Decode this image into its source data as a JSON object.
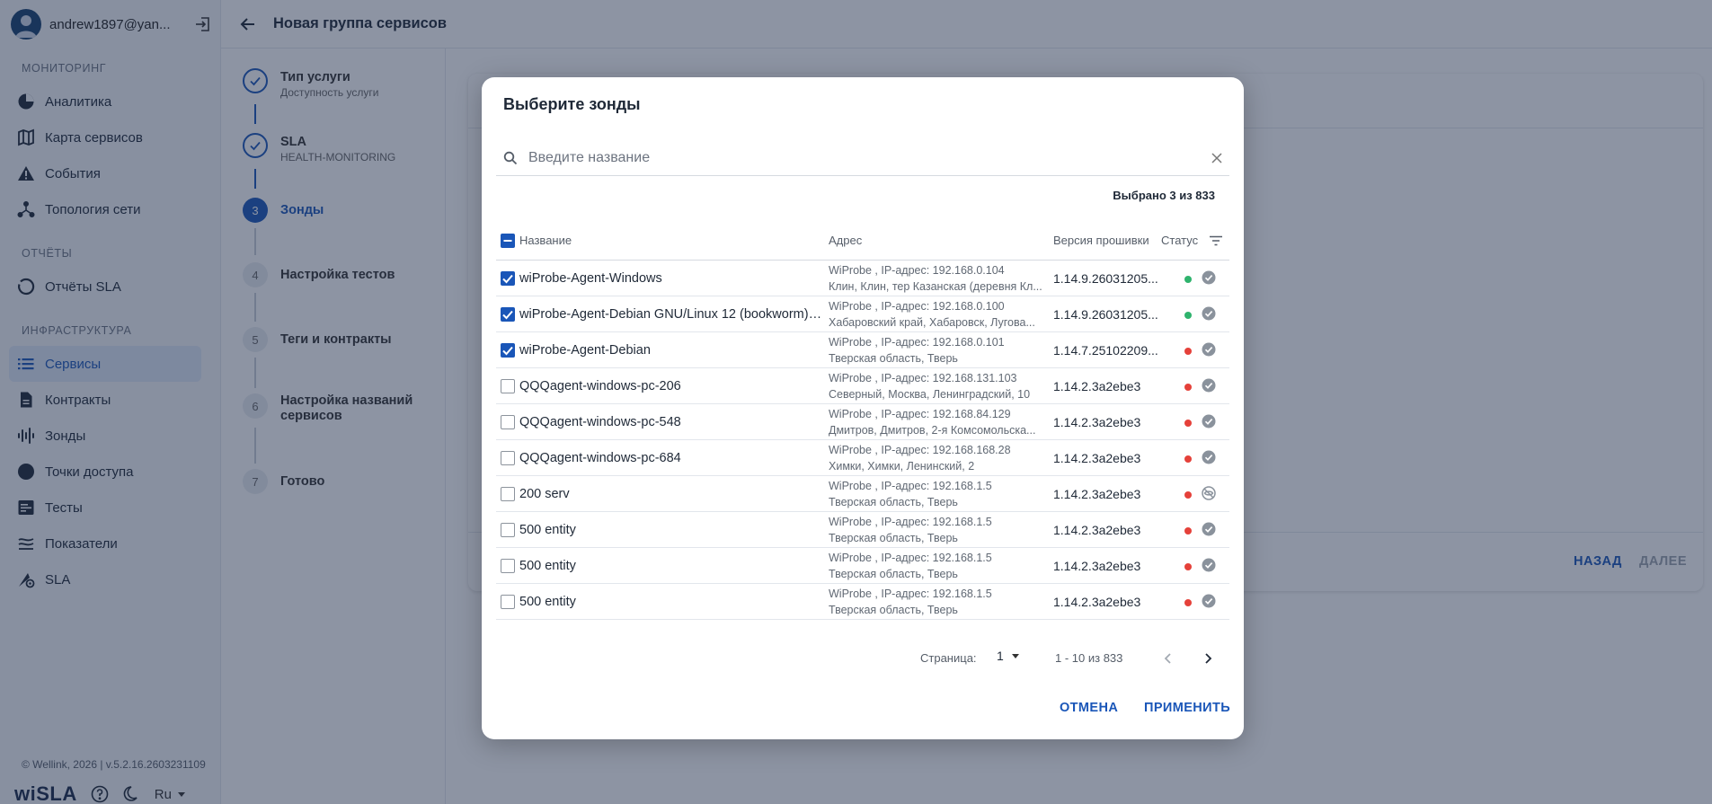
{
  "sidebar": {
    "user_email": "andrew1897@yan...",
    "sections": [
      {
        "title": "МОНИТОРИНГ",
        "items": [
          "Аналитика",
          "Карта сервисов",
          "События",
          "Топология сети"
        ]
      },
      {
        "title": "ОТЧЁТЫ",
        "items": [
          "Отчёты SLA"
        ]
      },
      {
        "title": "ИНФРАСТРУКТУРА",
        "items": [
          "Сервисы",
          "Контракты",
          "Зонды",
          "Точки доступа",
          "Тесты",
          "Показатели",
          "SLA"
        ]
      }
    ],
    "active_item": "Сервисы",
    "footer_copy": "© Wellink, 2026 | v.5.2.16.2603231109",
    "brand_wi": "wi",
    "brand_sla": "SLA",
    "language": "Ru"
  },
  "header": {
    "title": "Новая группа сервисов"
  },
  "stepper": {
    "steps": [
      {
        "number": "1",
        "title": "Тип услуги",
        "subtitle": "Доступность услуги",
        "state": "done"
      },
      {
        "number": "2",
        "title": "SLA",
        "subtitle": "HEALTH-MONITORING",
        "state": "done"
      },
      {
        "number": "3",
        "title": "Зонды",
        "subtitle": "",
        "state": "current"
      },
      {
        "number": "4",
        "title": "Настройка тестов",
        "subtitle": "",
        "state": "todo"
      },
      {
        "number": "5",
        "title": "Теги и контракты",
        "subtitle": "",
        "state": "todo"
      },
      {
        "number": "6",
        "title": "Настройка названий сервисов",
        "subtitle": "",
        "state": "todo"
      },
      {
        "number": "7",
        "title": "Готово",
        "subtitle": "",
        "state": "todo"
      }
    ]
  },
  "content": {
    "back_label": "НАЗАД",
    "next_label": "ДАЛЕЕ"
  },
  "dialog": {
    "title": "Выберите зонды",
    "search_placeholder": "Введите название",
    "selected_info": "Выбрано 3 из 833",
    "columns": {
      "name": "Название",
      "address": "Адрес",
      "firmware": "Версия прошивки",
      "status": "Статус"
    },
    "rows": [
      {
        "checked": true,
        "name": "wiProbe-Agent-Windows",
        "addr1": "WiProbe , IP-адрес: 192.168.0.104",
        "addr2": "Клин, Клин, тер Казанская (деревня Кл...",
        "firmware": "1.14.9.26031205...",
        "online": true,
        "icon": "check-circle-icon"
      },
      {
        "checked": true,
        "name": "wiProbe-Agent-Debian GNU/Linux 12 (bookworm)_...",
        "addr1": "WiProbe , IP-адрес: 192.168.0.100",
        "addr2": "Хабаровский край, Хабаровск, Лугова...",
        "firmware": "1.14.9.26031205...",
        "online": true,
        "icon": "check-circle-icon"
      },
      {
        "checked": true,
        "name": "wiProbe-Agent-Debian",
        "addr1": "WiProbe , IP-адрес: 192.168.0.101",
        "addr2": "Тверская область, Тверь",
        "firmware": "1.14.7.25102209...",
        "online": false,
        "icon": "check-circle-icon"
      },
      {
        "checked": false,
        "name": "QQQagent-windows-pc-206",
        "addr1": "WiProbe , IP-адрес: 192.168.131.103",
        "addr2": "Северный, Москва, Ленинградский, 10",
        "firmware": "1.14.2.3a2ebe3",
        "online": false,
        "icon": "check-circle-icon"
      },
      {
        "checked": false,
        "name": "QQQagent-windows-pc-548",
        "addr1": "WiProbe , IP-адрес: 192.168.84.129",
        "addr2": "Дмитров, Дмитров, 2-я Комсомольска...",
        "firmware": "1.14.2.3a2ebe3",
        "online": false,
        "icon": "check-circle-icon"
      },
      {
        "checked": false,
        "name": "QQQagent-windows-pc-684",
        "addr1": "WiProbe , IP-адрес: 192.168.168.28",
        "addr2": "Химки, Химки, Ленинский, 2",
        "firmware": "1.14.2.3a2ebe3",
        "online": false,
        "icon": "check-circle-icon"
      },
      {
        "checked": false,
        "name": "200 serv",
        "addr1": "WiProbe , IP-адрес: 192.168.1.5",
        "addr2": "Тверская область, Тверь",
        "firmware": "1.14.2.3a2ebe3",
        "online": false,
        "icon": "eye-off-icon"
      },
      {
        "checked": false,
        "name": "500 entity",
        "addr1": "WiProbe , IP-адрес: 192.168.1.5",
        "addr2": "Тверская область, Тверь",
        "firmware": "1.14.2.3a2ebe3",
        "online": false,
        "icon": "check-circle-icon"
      },
      {
        "checked": false,
        "name": "500 entity",
        "addr1": "WiProbe , IP-адрес: 192.168.1.5",
        "addr2": "Тверская область, Тверь",
        "firmware": "1.14.2.3a2ebe3",
        "online": false,
        "icon": "check-circle-icon"
      },
      {
        "checked": false,
        "name": "500 entity",
        "addr1": "WiProbe , IP-адрес: 192.168.1.5",
        "addr2": "Тверская область, Тверь",
        "firmware": "1.14.2.3a2ebe3",
        "online": false,
        "icon": "check-circle-icon"
      }
    ],
    "pager": {
      "label": "Страница:",
      "page": "1",
      "range": "1 - 10 из 833"
    },
    "cancel_label": "ОТМЕНА",
    "apply_label": "ПРИМЕНИТЬ"
  },
  "colors": {
    "accent": "#1a56b8",
    "online": "#2fb36d",
    "offline": "#e5413a",
    "overlay": "#1c2a48"
  }
}
